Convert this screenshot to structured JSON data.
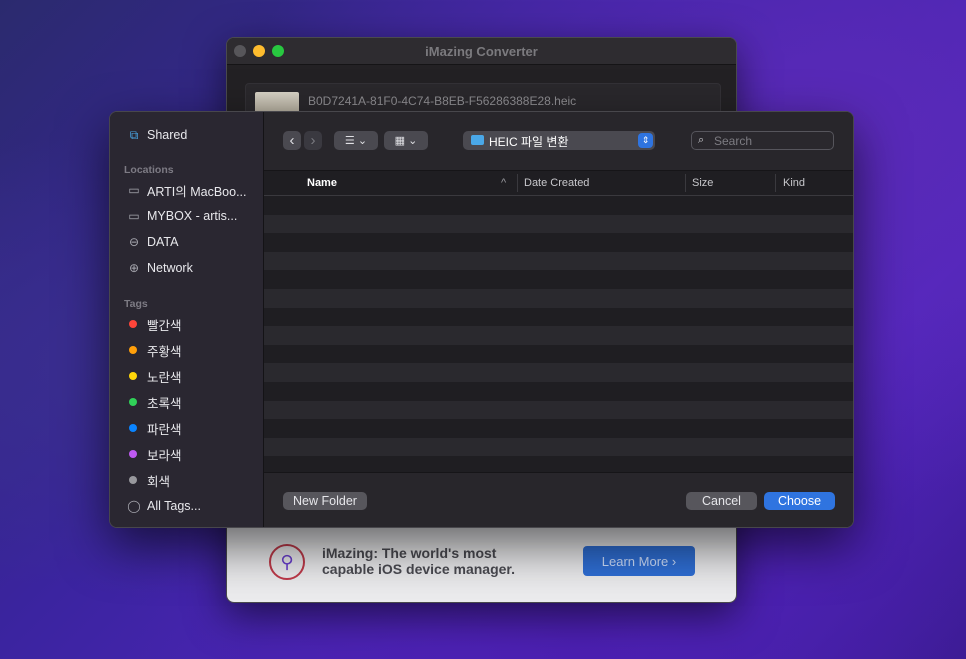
{
  "converter": {
    "title": "iMazing Converter",
    "file_name": "B0D7241A-81F0-4C74-B8EB-F56286388E28.heic",
    "promo_text": "iMazing: The world's most capable iOS device manager.",
    "learn_more": "Learn More ›"
  },
  "sidebar": {
    "top_item": "Shared",
    "locations_label": "Locations",
    "locations": [
      {
        "label": "ARTI의 MacBoo...",
        "icon": "laptop-icon"
      },
      {
        "label": "MYBOX - artis...",
        "icon": "folder-icon"
      },
      {
        "label": "DATA",
        "icon": "drive-icon"
      },
      {
        "label": "Network",
        "icon": "globe-icon"
      }
    ],
    "tags_label": "Tags",
    "tags": [
      {
        "label": "빨간색",
        "color": "#ff453a"
      },
      {
        "label": "주황색",
        "color": "#ff9f0a"
      },
      {
        "label": "노란색",
        "color": "#ffd60a"
      },
      {
        "label": "초록색",
        "color": "#30d158"
      },
      {
        "label": "파란색",
        "color": "#0a84ff"
      },
      {
        "label": "보라색",
        "color": "#bf5af2"
      },
      {
        "label": "회색",
        "color": "#98989d"
      }
    ],
    "all_tags": "All Tags..."
  },
  "toolbar": {
    "back": "‹",
    "forward": "›",
    "list_view": "☰ ⌄",
    "grid_view": "▦ ⌄",
    "current_folder": "HEIC 파일 변환",
    "search_placeholder": "Search"
  },
  "columns": {
    "name": "Name",
    "sort_indicator": "^",
    "date_created": "Date Created",
    "size": "Size",
    "kind": "Kind"
  },
  "footer": {
    "new_folder": "New Folder",
    "cancel": "Cancel",
    "choose": "Choose"
  }
}
